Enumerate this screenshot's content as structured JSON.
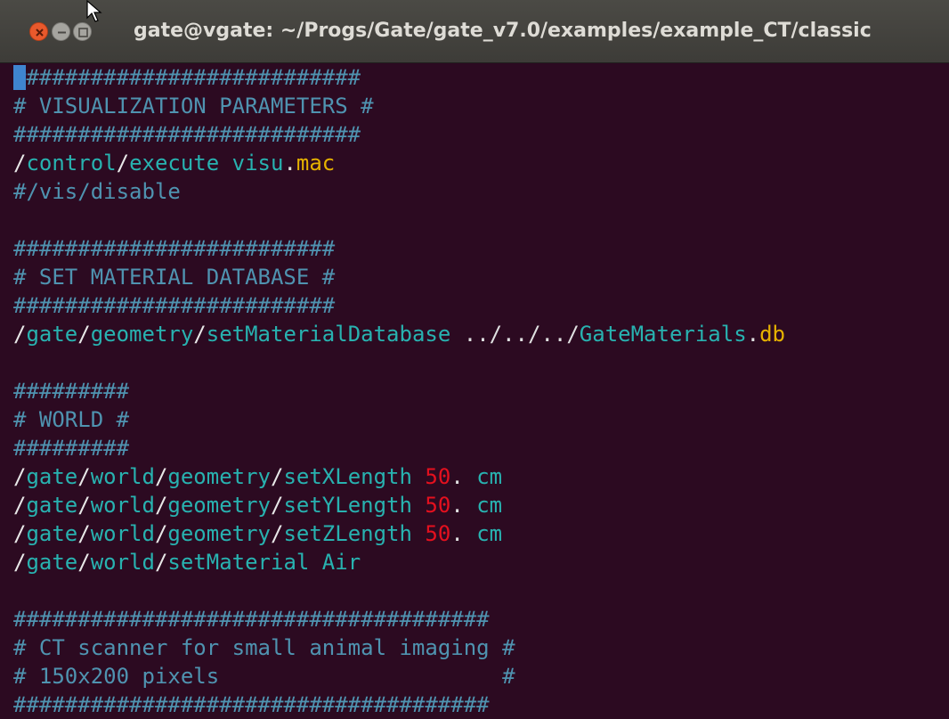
{
  "window": {
    "title": "gate@vgate: ~/Progs/Gate/gate_v7.0/examples/example_CT/classic"
  },
  "colors": {
    "background": "#2c0a21",
    "comment": "#4f93b0",
    "slash": "#e8e8e8",
    "command": "#28b2b0",
    "number": "#e4101e",
    "extension": "#e6b200",
    "cursor": "#3f85cf"
  },
  "terminal": {
    "lines": [
      [
        {
          "t": "#",
          "s": "cursor"
        },
        {
          "t": "##########################",
          "s": "comment"
        }
      ],
      [
        {
          "t": "# VISUALIZATION PARAMETERS #",
          "s": "comment"
        }
      ],
      [
        {
          "t": "###########################",
          "s": "comment"
        }
      ],
      [
        {
          "t": "/",
          "s": "slash"
        },
        {
          "t": "control",
          "s": "cmd"
        },
        {
          "t": "/",
          "s": "slash"
        },
        {
          "t": "execute visu",
          "s": "cmd"
        },
        {
          "t": ".",
          "s": "plain"
        },
        {
          "t": "mac",
          "s": "ext"
        }
      ],
      [
        {
          "t": "#/vis/disable",
          "s": "comment"
        }
      ],
      [],
      [
        {
          "t": "#########################",
          "s": "comment"
        }
      ],
      [
        {
          "t": "# SET MATERIAL DATABASE #",
          "s": "comment"
        }
      ],
      [
        {
          "t": "#########################",
          "s": "comment"
        }
      ],
      [
        {
          "t": "/",
          "s": "slash"
        },
        {
          "t": "gate",
          "s": "cmd"
        },
        {
          "t": "/",
          "s": "slash"
        },
        {
          "t": "geometry",
          "s": "cmd"
        },
        {
          "t": "/",
          "s": "slash"
        },
        {
          "t": "setMaterialDatabase",
          "s": "cmd"
        },
        {
          "t": " ../../../",
          "s": "plain"
        },
        {
          "t": "GateMaterials",
          "s": "cmd"
        },
        {
          "t": ".",
          "s": "plain"
        },
        {
          "t": "db",
          "s": "ext"
        }
      ],
      [],
      [
        {
          "t": "#########",
          "s": "comment"
        }
      ],
      [
        {
          "t": "# WORLD #",
          "s": "comment"
        }
      ],
      [
        {
          "t": "#########",
          "s": "comment"
        }
      ],
      [
        {
          "t": "/",
          "s": "slash"
        },
        {
          "t": "gate",
          "s": "cmd"
        },
        {
          "t": "/",
          "s": "slash"
        },
        {
          "t": "world",
          "s": "cmd"
        },
        {
          "t": "/",
          "s": "slash"
        },
        {
          "t": "geometry",
          "s": "cmd"
        },
        {
          "t": "/",
          "s": "slash"
        },
        {
          "t": "setXLength ",
          "s": "cmd"
        },
        {
          "t": "50",
          "s": "num"
        },
        {
          "t": ". ",
          "s": "plain"
        },
        {
          "t": "cm",
          "s": "cmd"
        }
      ],
      [
        {
          "t": "/",
          "s": "slash"
        },
        {
          "t": "gate",
          "s": "cmd"
        },
        {
          "t": "/",
          "s": "slash"
        },
        {
          "t": "world",
          "s": "cmd"
        },
        {
          "t": "/",
          "s": "slash"
        },
        {
          "t": "geometry",
          "s": "cmd"
        },
        {
          "t": "/",
          "s": "slash"
        },
        {
          "t": "setYLength ",
          "s": "cmd"
        },
        {
          "t": "50",
          "s": "num"
        },
        {
          "t": ". ",
          "s": "plain"
        },
        {
          "t": "cm",
          "s": "cmd"
        }
      ],
      [
        {
          "t": "/",
          "s": "slash"
        },
        {
          "t": "gate",
          "s": "cmd"
        },
        {
          "t": "/",
          "s": "slash"
        },
        {
          "t": "world",
          "s": "cmd"
        },
        {
          "t": "/",
          "s": "slash"
        },
        {
          "t": "geometry",
          "s": "cmd"
        },
        {
          "t": "/",
          "s": "slash"
        },
        {
          "t": "setZLength ",
          "s": "cmd"
        },
        {
          "t": "50",
          "s": "num"
        },
        {
          "t": ". ",
          "s": "plain"
        },
        {
          "t": "cm",
          "s": "cmd"
        }
      ],
      [
        {
          "t": "/",
          "s": "slash"
        },
        {
          "t": "gate",
          "s": "cmd"
        },
        {
          "t": "/",
          "s": "slash"
        },
        {
          "t": "world",
          "s": "cmd"
        },
        {
          "t": "/",
          "s": "slash"
        },
        {
          "t": "setMaterial Air",
          "s": "cmd"
        }
      ],
      [],
      [
        {
          "t": "#####################################",
          "s": "comment"
        }
      ],
      [
        {
          "t": "# CT scanner for small animal imaging #",
          "s": "comment"
        }
      ],
      [
        {
          "t": "# 150x200 pixels                      #",
          "s": "comment"
        }
      ],
      [
        {
          "t": "#####################################",
          "s": "comment"
        }
      ]
    ]
  }
}
